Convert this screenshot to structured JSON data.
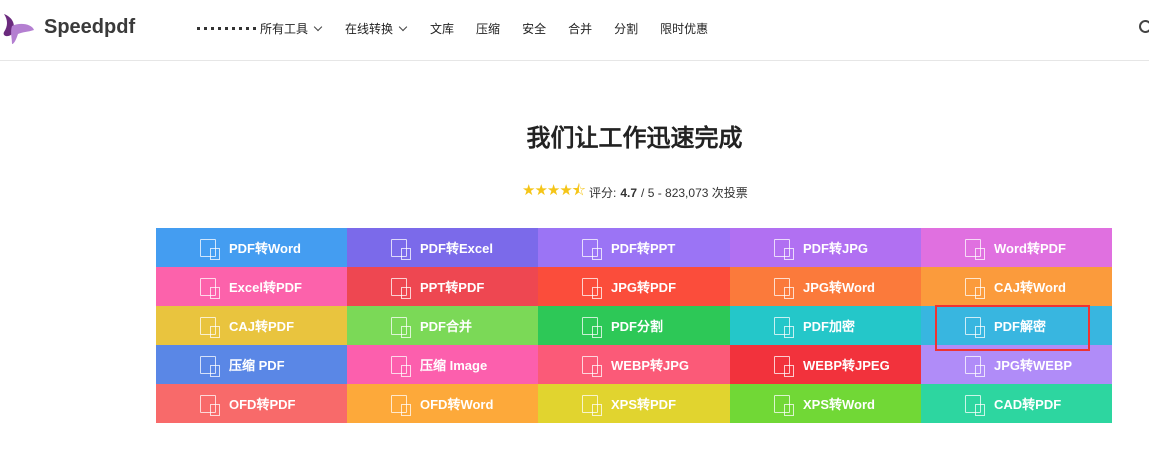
{
  "header": {
    "brand": "Speedpdf",
    "nav": [
      {
        "label": "所有工具",
        "dropdown": true,
        "grid": true
      },
      {
        "label": "在线转换",
        "dropdown": true
      },
      {
        "label": "文库"
      },
      {
        "label": "压缩"
      },
      {
        "label": "安全"
      },
      {
        "label": "合并"
      },
      {
        "label": "分割"
      },
      {
        "label": "限时优惠"
      }
    ]
  },
  "hero": {
    "title": "我们让工作迅速完成",
    "rating_label": "评分:",
    "rating_value": "4.7",
    "rating_rest": "/ 5 - 823,073 次投票",
    "stars": 4.5
  },
  "tools": [
    {
      "label": "PDF转Word",
      "color": "#449df1"
    },
    {
      "label": "PDF转Excel",
      "color": "#7b6aea"
    },
    {
      "label": "PDF转PPT",
      "color": "#9b74f5"
    },
    {
      "label": "PDF转JPG",
      "color": "#b170f2"
    },
    {
      "label": "Word转PDF",
      "color": "#e070e0"
    },
    {
      "label": "Excel转PDF",
      "color": "#fc62ab"
    },
    {
      "label": "PPT转PDF",
      "color": "#ee4751"
    },
    {
      "label": "JPG转PDF",
      "color": "#fb4d3b"
    },
    {
      "label": "JPG转Word",
      "color": "#fb7a3b"
    },
    {
      "label": "CAJ转Word",
      "color": "#fb9b3c"
    },
    {
      "label": "CAJ转PDF",
      "color": "#e9c43e"
    },
    {
      "label": "PDF合并",
      "color": "#7bd957"
    },
    {
      "label": "PDF分割",
      "color": "#2dc857"
    },
    {
      "label": "PDF加密",
      "color": "#24c7c9"
    },
    {
      "label": "PDF解密",
      "color": "#38b6e0"
    },
    {
      "label": "压缩 PDF",
      "color": "#5a87e6"
    },
    {
      "label": "压缩 Image",
      "color": "#fc5fad"
    },
    {
      "label": "WEBP转JPG",
      "color": "#fb5a78"
    },
    {
      "label": "WEBP转JPEG",
      "color": "#f2323c"
    },
    {
      "label": "JPG转WEBP",
      "color": "#b08cf8"
    },
    {
      "label": "OFD转PDF",
      "color": "#f86a6a"
    },
    {
      "label": "OFD转Word",
      "color": "#fda93a"
    },
    {
      "label": "XPS转PDF",
      "color": "#e1d42f"
    },
    {
      "label": "XPS转Word",
      "color": "#71d836"
    },
    {
      "label": "CAD转PDF",
      "color": "#2dd6a0"
    }
  ],
  "highlight_color": "#ee3333"
}
